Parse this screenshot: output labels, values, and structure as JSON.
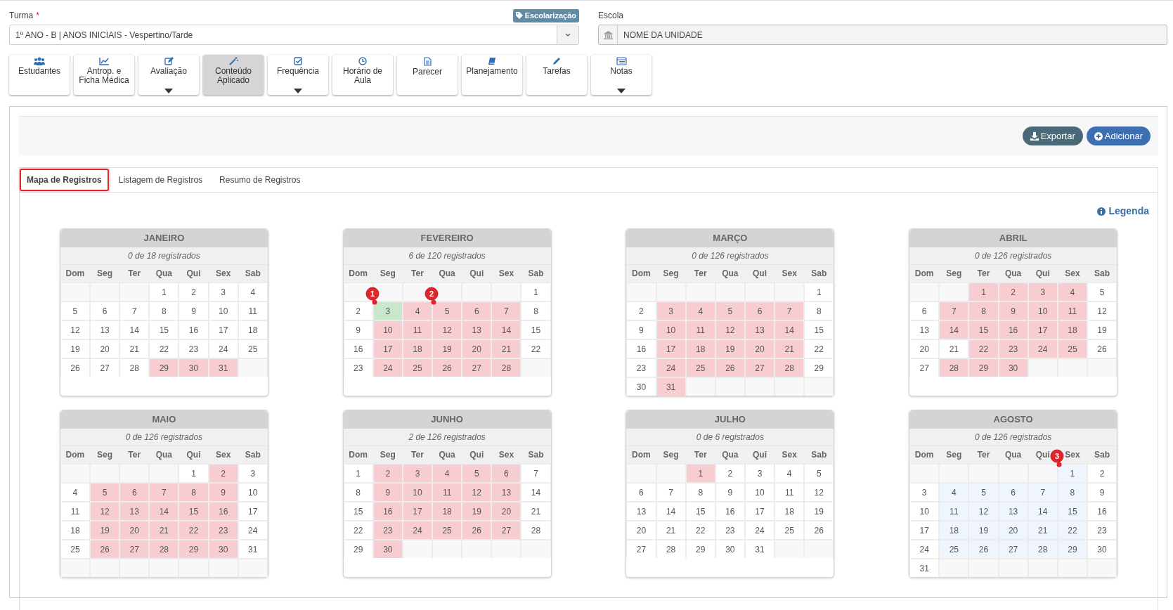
{
  "turma": {
    "label": "Turma",
    "required_mark": "*",
    "value": "1º ANO - B | ANOS INICIAIS - Vespertino/Tarde"
  },
  "tag": "Escolarização",
  "escola": {
    "label": "Escola",
    "value": "NOME DA UNIDADE"
  },
  "toolbar": [
    {
      "label": "Estudantes",
      "dropdown": false,
      "selected": false
    },
    {
      "label": "Antrop. e\nFicha Médica",
      "dropdown": false,
      "selected": false
    },
    {
      "label": "Avaliação",
      "dropdown": true,
      "selected": false
    },
    {
      "label": "Conteúdo\nAplicado",
      "dropdown": false,
      "selected": true
    },
    {
      "label": "Frequência",
      "dropdown": true,
      "selected": false
    },
    {
      "label": "Horário de\nAula",
      "dropdown": false,
      "selected": false
    },
    {
      "label": "Parecer",
      "dropdown": false,
      "selected": false
    },
    {
      "label": "Planejamento",
      "dropdown": false,
      "selected": false
    },
    {
      "label": "Tarefas",
      "dropdown": false,
      "selected": false
    },
    {
      "label": "Notas",
      "dropdown": true,
      "selected": false
    }
  ],
  "actions": [
    {
      "label": "Exportar",
      "kind": "export"
    },
    {
      "label": "Adicionar",
      "kind": "add"
    }
  ],
  "tabs": [
    {
      "label": "Mapa de Registros",
      "selected": true
    },
    {
      "label": "Listagem de Registros",
      "selected": false
    },
    {
      "label": "Resumo de Registros",
      "selected": false
    }
  ],
  "legend_link": "Legenda",
  "months": [
    {
      "name": "JANEIRO",
      "summary": "0 de 18 registrados",
      "weekdays": [
        "Dom",
        "Seg",
        "Ter",
        "Qua",
        "Qui",
        "Sex",
        "Sab"
      ],
      "weeks": [
        [
          {
            "kind": "none"
          },
          {
            "kind": "none"
          },
          {
            "kind": "none"
          },
          {
            "day": "1",
            "kind": "open"
          },
          {
            "day": "2",
            "kind": "open"
          },
          {
            "day": "3",
            "kind": "open"
          },
          {
            "day": "4",
            "kind": "open"
          }
        ],
        [
          {
            "day": "5",
            "kind": "open"
          },
          {
            "day": "6",
            "kind": "open"
          },
          {
            "day": "7",
            "kind": "open"
          },
          {
            "day": "8",
            "kind": "open"
          },
          {
            "day": "9",
            "kind": "open"
          },
          {
            "day": "10",
            "kind": "open"
          },
          {
            "day": "11",
            "kind": "open"
          }
        ],
        [
          {
            "day": "12",
            "kind": "open"
          },
          {
            "day": "13",
            "kind": "open"
          },
          {
            "day": "14",
            "kind": "open"
          },
          {
            "day": "15",
            "kind": "open"
          },
          {
            "day": "16",
            "kind": "open"
          },
          {
            "day": "17",
            "kind": "open"
          },
          {
            "day": "18",
            "kind": "open"
          }
        ],
        [
          {
            "day": "19",
            "kind": "open"
          },
          {
            "day": "20",
            "kind": "open"
          },
          {
            "day": "21",
            "kind": "open"
          },
          {
            "day": "22",
            "kind": "open"
          },
          {
            "day": "23",
            "kind": "open"
          },
          {
            "day": "24",
            "kind": "open"
          },
          {
            "day": "25",
            "kind": "open"
          }
        ],
        [
          {
            "day": "26",
            "kind": "open"
          },
          {
            "day": "27",
            "kind": "open"
          },
          {
            "day": "28",
            "kind": "open"
          },
          {
            "day": "29",
            "kind": "pending"
          },
          {
            "day": "30",
            "kind": "pending"
          },
          {
            "day": "31",
            "kind": "pending"
          },
          {
            "kind": "none"
          }
        ]
      ]
    },
    {
      "name": "FEVEREIRO",
      "summary": "6 de 120 registrados",
      "weekdays": [
        "Dom",
        "Seg",
        "Ter",
        "Qua",
        "Qui",
        "Sex",
        "Sab"
      ],
      "weeks": [
        [
          {
            "kind": "none"
          },
          {
            "kind": "none"
          },
          {
            "kind": "none"
          },
          {
            "kind": "none"
          },
          {
            "kind": "none"
          },
          {
            "kind": "none"
          },
          {
            "day": "1",
            "kind": "open"
          }
        ],
        [
          {
            "day": "2",
            "kind": "open"
          },
          {
            "day": "3",
            "kind": "done",
            "marker": "1"
          },
          {
            "day": "4",
            "kind": "pending"
          },
          {
            "day": "5",
            "kind": "pending",
            "marker": "2"
          },
          {
            "day": "6",
            "kind": "pending"
          },
          {
            "day": "7",
            "kind": "pending"
          },
          {
            "day": "8",
            "kind": "open"
          }
        ],
        [
          {
            "day": "9",
            "kind": "open"
          },
          {
            "day": "10",
            "kind": "pending"
          },
          {
            "day": "11",
            "kind": "pending"
          },
          {
            "day": "12",
            "kind": "pending"
          },
          {
            "day": "13",
            "kind": "pending"
          },
          {
            "day": "14",
            "kind": "pending"
          },
          {
            "day": "15",
            "kind": "open"
          }
        ],
        [
          {
            "day": "16",
            "kind": "open"
          },
          {
            "day": "17",
            "kind": "pending"
          },
          {
            "day": "18",
            "kind": "pending"
          },
          {
            "day": "19",
            "kind": "pending"
          },
          {
            "day": "20",
            "kind": "pending"
          },
          {
            "day": "21",
            "kind": "pending"
          },
          {
            "day": "22",
            "kind": "open"
          }
        ],
        [
          {
            "day": "23",
            "kind": "open"
          },
          {
            "day": "24",
            "kind": "pending"
          },
          {
            "day": "25",
            "kind": "pending"
          },
          {
            "day": "26",
            "kind": "pending"
          },
          {
            "day": "27",
            "kind": "pending"
          },
          {
            "day": "28",
            "kind": "pending"
          },
          {
            "kind": "none"
          }
        ]
      ]
    },
    {
      "name": "MARÇO",
      "summary": "0 de 126 registrados",
      "weekdays": [
        "Dom",
        "Seg",
        "Ter",
        "Qua",
        "Qui",
        "Sex",
        "Sab"
      ],
      "weeks": [
        [
          {
            "kind": "none"
          },
          {
            "kind": "none"
          },
          {
            "kind": "none"
          },
          {
            "kind": "none"
          },
          {
            "kind": "none"
          },
          {
            "kind": "none"
          },
          {
            "day": "1",
            "kind": "open"
          }
        ],
        [
          {
            "day": "2",
            "kind": "open"
          },
          {
            "day": "3",
            "kind": "pending"
          },
          {
            "day": "4",
            "kind": "pending"
          },
          {
            "day": "5",
            "kind": "pending"
          },
          {
            "day": "6",
            "kind": "pending"
          },
          {
            "day": "7",
            "kind": "pending"
          },
          {
            "day": "8",
            "kind": "open"
          }
        ],
        [
          {
            "day": "9",
            "kind": "open"
          },
          {
            "day": "10",
            "kind": "pending"
          },
          {
            "day": "11",
            "kind": "pending"
          },
          {
            "day": "12",
            "kind": "pending"
          },
          {
            "day": "13",
            "kind": "pending"
          },
          {
            "day": "14",
            "kind": "pending"
          },
          {
            "day": "15",
            "kind": "open"
          }
        ],
        [
          {
            "day": "16",
            "kind": "open"
          },
          {
            "day": "17",
            "kind": "pending"
          },
          {
            "day": "18",
            "kind": "pending"
          },
          {
            "day": "19",
            "kind": "pending"
          },
          {
            "day": "20",
            "kind": "pending"
          },
          {
            "day": "21",
            "kind": "pending"
          },
          {
            "day": "22",
            "kind": "open"
          }
        ],
        [
          {
            "day": "23",
            "kind": "open"
          },
          {
            "day": "24",
            "kind": "pending"
          },
          {
            "day": "25",
            "kind": "pending"
          },
          {
            "day": "26",
            "kind": "pending"
          },
          {
            "day": "27",
            "kind": "pending"
          },
          {
            "day": "28",
            "kind": "pending"
          },
          {
            "day": "29",
            "kind": "open"
          }
        ],
        [
          {
            "day": "30",
            "kind": "open"
          },
          {
            "day": "31",
            "kind": "pending"
          },
          {
            "kind": "none"
          },
          {
            "kind": "none"
          },
          {
            "kind": "none"
          },
          {
            "kind": "none"
          },
          {
            "kind": "none"
          }
        ]
      ]
    },
    {
      "name": "ABRIL",
      "summary": "0 de 126 registrados",
      "weekdays": [
        "Dom",
        "Seg",
        "Ter",
        "Qua",
        "Qui",
        "Sex",
        "Sab"
      ],
      "weeks": [
        [
          {
            "kind": "none"
          },
          {
            "kind": "none"
          },
          {
            "day": "1",
            "kind": "pending"
          },
          {
            "day": "2",
            "kind": "pending"
          },
          {
            "day": "3",
            "kind": "pending"
          },
          {
            "day": "4",
            "kind": "pending"
          },
          {
            "day": "5",
            "kind": "open"
          }
        ],
        [
          {
            "day": "6",
            "kind": "open"
          },
          {
            "day": "7",
            "kind": "pending"
          },
          {
            "day": "8",
            "kind": "pending"
          },
          {
            "day": "9",
            "kind": "pending"
          },
          {
            "day": "10",
            "kind": "pending"
          },
          {
            "day": "11",
            "kind": "pending"
          },
          {
            "day": "12",
            "kind": "open"
          }
        ],
        [
          {
            "day": "13",
            "kind": "open"
          },
          {
            "day": "14",
            "kind": "pending"
          },
          {
            "day": "15",
            "kind": "pending"
          },
          {
            "day": "16",
            "kind": "pending"
          },
          {
            "day": "17",
            "kind": "pending"
          },
          {
            "day": "18",
            "kind": "pending"
          },
          {
            "day": "19",
            "kind": "open"
          }
        ],
        [
          {
            "day": "20",
            "kind": "open"
          },
          {
            "day": "21",
            "kind": "open"
          },
          {
            "day": "22",
            "kind": "pending"
          },
          {
            "day": "23",
            "kind": "pending"
          },
          {
            "day": "24",
            "kind": "pending"
          },
          {
            "day": "25",
            "kind": "pending"
          },
          {
            "day": "26",
            "kind": "open"
          }
        ],
        [
          {
            "day": "27",
            "kind": "open"
          },
          {
            "day": "28",
            "kind": "pending"
          },
          {
            "day": "29",
            "kind": "pending"
          },
          {
            "day": "30",
            "kind": "pending"
          },
          {
            "kind": "none"
          },
          {
            "kind": "none"
          },
          {
            "kind": "none"
          }
        ]
      ]
    },
    {
      "name": "MAIO",
      "summary": "0 de 126 registrados",
      "weekdays": [
        "Dom",
        "Seg",
        "Ter",
        "Qua",
        "Qui",
        "Sex",
        "Sab"
      ],
      "weeks": [
        [
          {
            "kind": "none"
          },
          {
            "kind": "none"
          },
          {
            "kind": "none"
          },
          {
            "kind": "none"
          },
          {
            "day": "1",
            "kind": "open"
          },
          {
            "day": "2",
            "kind": "pending"
          },
          {
            "day": "3",
            "kind": "open"
          }
        ],
        [
          {
            "day": "4",
            "kind": "open"
          },
          {
            "day": "5",
            "kind": "pending"
          },
          {
            "day": "6",
            "kind": "pending"
          },
          {
            "day": "7",
            "kind": "pending"
          },
          {
            "day": "8",
            "kind": "pending"
          },
          {
            "day": "9",
            "kind": "pending"
          },
          {
            "day": "10",
            "kind": "open"
          }
        ],
        [
          {
            "day": "11",
            "kind": "open"
          },
          {
            "day": "12",
            "kind": "pending"
          },
          {
            "day": "13",
            "kind": "pending"
          },
          {
            "day": "14",
            "kind": "pending"
          },
          {
            "day": "15",
            "kind": "pending"
          },
          {
            "day": "16",
            "kind": "pending"
          },
          {
            "day": "17",
            "kind": "open"
          }
        ],
        [
          {
            "day": "18",
            "kind": "open"
          },
          {
            "day": "19",
            "kind": "pending"
          },
          {
            "day": "20",
            "kind": "pending"
          },
          {
            "day": "21",
            "kind": "pending"
          },
          {
            "day": "22",
            "kind": "pending"
          },
          {
            "day": "23",
            "kind": "pending"
          },
          {
            "day": "24",
            "kind": "open"
          }
        ],
        [
          {
            "day": "25",
            "kind": "open"
          },
          {
            "day": "26",
            "kind": "pending"
          },
          {
            "day": "27",
            "kind": "pending"
          },
          {
            "day": "28",
            "kind": "pending"
          },
          {
            "day": "29",
            "kind": "pending"
          },
          {
            "day": "30",
            "kind": "pending"
          },
          {
            "day": "31",
            "kind": "open"
          }
        ],
        [
          {
            "kind": "none"
          },
          {
            "kind": "none"
          },
          {
            "kind": "none"
          },
          {
            "kind": "none"
          },
          {
            "kind": "none"
          },
          {
            "kind": "none"
          },
          {
            "kind": "none"
          }
        ]
      ]
    },
    {
      "name": "JUNHO",
      "summary": "2 de 126 registrados",
      "weekdays": [
        "Dom",
        "Seg",
        "Ter",
        "Qua",
        "Qui",
        "Sex",
        "Sab"
      ],
      "weeks": [
        [
          {
            "day": "1",
            "kind": "open"
          },
          {
            "day": "2",
            "kind": "pending"
          },
          {
            "day": "3",
            "kind": "pending"
          },
          {
            "day": "4",
            "kind": "pending"
          },
          {
            "day": "5",
            "kind": "pending"
          },
          {
            "day": "6",
            "kind": "pending"
          },
          {
            "day": "7",
            "kind": "open"
          }
        ],
        [
          {
            "day": "8",
            "kind": "open"
          },
          {
            "day": "9",
            "kind": "pending"
          },
          {
            "day": "10",
            "kind": "pending"
          },
          {
            "day": "11",
            "kind": "pending"
          },
          {
            "day": "12",
            "kind": "pending"
          },
          {
            "day": "13",
            "kind": "pending"
          },
          {
            "day": "14",
            "kind": "open"
          }
        ],
        [
          {
            "day": "15",
            "kind": "open"
          },
          {
            "day": "16",
            "kind": "pending"
          },
          {
            "day": "17",
            "kind": "pending"
          },
          {
            "day": "18",
            "kind": "pending"
          },
          {
            "day": "19",
            "kind": "pending"
          },
          {
            "day": "20",
            "kind": "pending"
          },
          {
            "day": "21",
            "kind": "open"
          }
        ],
        [
          {
            "day": "22",
            "kind": "open"
          },
          {
            "day": "23",
            "kind": "pending"
          },
          {
            "day": "24",
            "kind": "pending"
          },
          {
            "day": "25",
            "kind": "pending"
          },
          {
            "day": "26",
            "kind": "pending"
          },
          {
            "day": "27",
            "kind": "pending"
          },
          {
            "day": "28",
            "kind": "open"
          }
        ],
        [
          {
            "day": "29",
            "kind": "open"
          },
          {
            "day": "30",
            "kind": "pending"
          },
          {
            "kind": "none"
          },
          {
            "kind": "none"
          },
          {
            "kind": "none"
          },
          {
            "kind": "none"
          },
          {
            "kind": "none"
          }
        ]
      ]
    },
    {
      "name": "JULHO",
      "summary": "0 de 6 registrados",
      "weekdays": [
        "Dom",
        "Seg",
        "Ter",
        "Qua",
        "Qui",
        "Sex",
        "Sab"
      ],
      "weeks": [
        [
          {
            "kind": "none"
          },
          {
            "kind": "none"
          },
          {
            "day": "1",
            "kind": "pending"
          },
          {
            "day": "2",
            "kind": "open"
          },
          {
            "day": "3",
            "kind": "open"
          },
          {
            "day": "4",
            "kind": "open"
          },
          {
            "day": "5",
            "kind": "open"
          }
        ],
        [
          {
            "day": "6",
            "kind": "open"
          },
          {
            "day": "7",
            "kind": "open"
          },
          {
            "day": "8",
            "kind": "open"
          },
          {
            "day": "9",
            "kind": "open"
          },
          {
            "day": "10",
            "kind": "open"
          },
          {
            "day": "11",
            "kind": "open"
          },
          {
            "day": "12",
            "kind": "open"
          }
        ],
        [
          {
            "day": "13",
            "kind": "open"
          },
          {
            "day": "14",
            "kind": "open"
          },
          {
            "day": "15",
            "kind": "open"
          },
          {
            "day": "16",
            "kind": "open"
          },
          {
            "day": "17",
            "kind": "open"
          },
          {
            "day": "18",
            "kind": "open"
          },
          {
            "day": "19",
            "kind": "open"
          }
        ],
        [
          {
            "day": "20",
            "kind": "open"
          },
          {
            "day": "21",
            "kind": "open"
          },
          {
            "day": "22",
            "kind": "open"
          },
          {
            "day": "23",
            "kind": "open"
          },
          {
            "day": "24",
            "kind": "open"
          },
          {
            "day": "25",
            "kind": "open"
          },
          {
            "day": "26",
            "kind": "open"
          }
        ],
        [
          {
            "day": "27",
            "kind": "open"
          },
          {
            "day": "28",
            "kind": "open"
          },
          {
            "day": "29",
            "kind": "open"
          },
          {
            "day": "30",
            "kind": "open"
          },
          {
            "day": "31",
            "kind": "open"
          },
          {
            "kind": "none"
          },
          {
            "kind": "none"
          }
        ]
      ]
    },
    {
      "name": "AGOSTO",
      "summary": "0 de 126 registrados",
      "weekdays": [
        "Dom",
        "Seg",
        "Ter",
        "Qua",
        "Qui",
        "Sex",
        "Sab"
      ],
      "weeks": [
        [
          {
            "kind": "none"
          },
          {
            "kind": "none"
          },
          {
            "kind": "none"
          },
          {
            "kind": "none"
          },
          {
            "kind": "none"
          },
          {
            "day": "1",
            "kind": "upcoming",
            "marker": "3"
          },
          {
            "day": "2",
            "kind": "open"
          }
        ],
        [
          {
            "day": "3",
            "kind": "open"
          },
          {
            "day": "4",
            "kind": "upcoming"
          },
          {
            "day": "5",
            "kind": "upcoming"
          },
          {
            "day": "6",
            "kind": "upcoming"
          },
          {
            "day": "7",
            "kind": "upcoming"
          },
          {
            "day": "8",
            "kind": "upcoming"
          },
          {
            "day": "9",
            "kind": "open"
          }
        ],
        [
          {
            "day": "10",
            "kind": "open"
          },
          {
            "day": "11",
            "kind": "upcoming"
          },
          {
            "day": "12",
            "kind": "upcoming"
          },
          {
            "day": "13",
            "kind": "upcoming"
          },
          {
            "day": "14",
            "kind": "upcoming"
          },
          {
            "day": "15",
            "kind": "upcoming"
          },
          {
            "day": "16",
            "kind": "open"
          }
        ],
        [
          {
            "day": "17",
            "kind": "open"
          },
          {
            "day": "18",
            "kind": "upcoming"
          },
          {
            "day": "19",
            "kind": "upcoming"
          },
          {
            "day": "20",
            "kind": "upcoming"
          },
          {
            "day": "21",
            "kind": "upcoming"
          },
          {
            "day": "22",
            "kind": "upcoming"
          },
          {
            "day": "23",
            "kind": "open"
          }
        ],
        [
          {
            "day": "24",
            "kind": "open"
          },
          {
            "day": "25",
            "kind": "upcoming"
          },
          {
            "day": "26",
            "kind": "upcoming"
          },
          {
            "day": "27",
            "kind": "upcoming"
          },
          {
            "day": "28",
            "kind": "upcoming"
          },
          {
            "day": "29",
            "kind": "upcoming"
          },
          {
            "day": "30",
            "kind": "open"
          }
        ],
        [
          {
            "day": "31",
            "kind": "open"
          },
          {
            "kind": "none"
          },
          {
            "kind": "none"
          },
          {
            "kind": "none"
          },
          {
            "kind": "none"
          },
          {
            "kind": "none"
          },
          {
            "kind": "none"
          }
        ]
      ]
    }
  ]
}
